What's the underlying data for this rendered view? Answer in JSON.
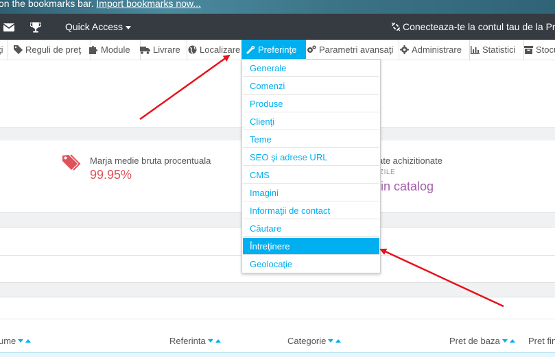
{
  "bookmarks_bar": {
    "text": "on the bookmarks bar. ",
    "link": "Import bookmarks now..."
  },
  "topbar": {
    "quick_access": "Quick Access",
    "connect": "Conecteaza-te la contul tau de la Presta"
  },
  "nav": {
    "items": [
      {
        "label": "ţi",
        "icon": ""
      },
      {
        "label": "Reguli de preţ",
        "icon": "tag-icon"
      },
      {
        "label": "Module",
        "icon": "puzzle-icon"
      },
      {
        "label": "Livrare",
        "icon": "truck-icon"
      },
      {
        "label": "Localizare",
        "icon": "globe-icon"
      },
      {
        "label": "Preferinţe",
        "icon": "wrench-icon"
      },
      {
        "label": "Parametri avansaţi",
        "icon": "cogs-icon"
      },
      {
        "label": "Administrare",
        "icon": "gear-icon"
      },
      {
        "label": "Statistici",
        "icon": "bar-chart-icon"
      },
      {
        "label": "Stocu",
        "icon": "archive-icon"
      }
    ]
  },
  "dropdown": {
    "items": [
      "Generale",
      "Comenzi",
      "Produse",
      "Clienţi",
      "Teme",
      "SEO şi adrese URL",
      "CMS",
      "Imagini",
      "Informaţii de contact",
      "Căutare",
      "Întreţinere",
      "Geolocaţie"
    ],
    "active_index": 10
  },
  "kpi": {
    "margin_label": "Marja medie bruta procentuala",
    "margin_value": "99.95%",
    "second_label": "ate achizitionate",
    "second_sub": "ZILE",
    "second_value": "lin catalog"
  },
  "table": {
    "columns": [
      "ume",
      "Referinta",
      "Categorie",
      "Pret de baza",
      "Pret fin"
    ]
  },
  "colors": {
    "accent": "#00aff0",
    "topbar": "#363a41",
    "kpi_red": "#e0525b",
    "kpi_purple": "#a25eac",
    "arrow": "#e8101a"
  }
}
